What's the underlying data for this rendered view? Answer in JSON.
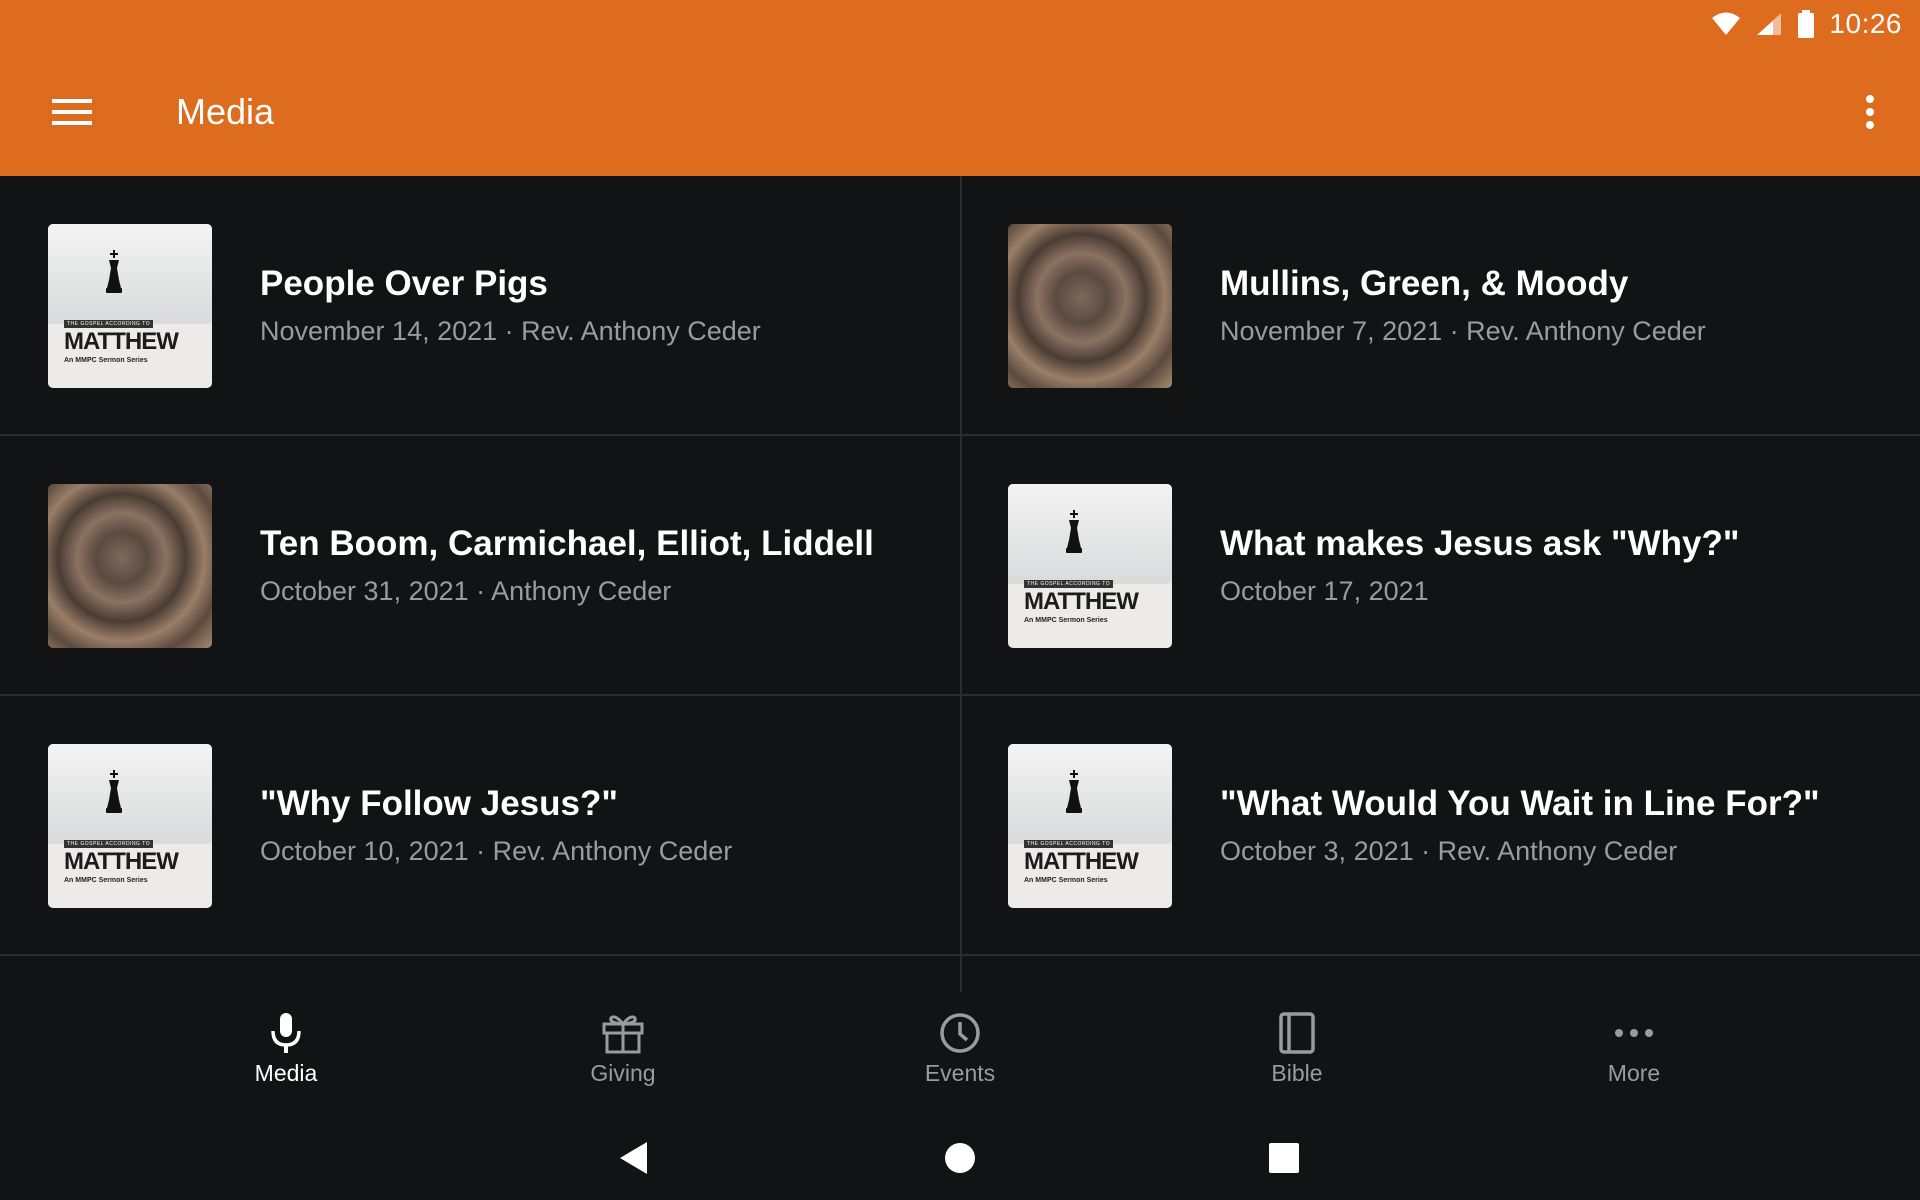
{
  "status_bar": {
    "time": "10:26"
  },
  "app_bar": {
    "title": "Media"
  },
  "items": [
    {
      "title": "People Over Pigs",
      "meta": "November 14, 2021 · Rev. Anthony Ceder",
      "thumbnail": "matthew-series"
    },
    {
      "title": "Mullins, Green, & Moody",
      "meta": "November 7, 2021 · Rev. Anthony Ceder",
      "thumbnail": "wood-texture"
    },
    {
      "title": "Ten Boom, Carmichael, Elliot, Liddell",
      "meta": "October 31, 2021 · Anthony Ceder",
      "thumbnail": "wood-texture"
    },
    {
      "title": "What makes Jesus ask \"Why?\"",
      "meta": "October 17, 2021",
      "thumbnail": "matthew-series"
    },
    {
      "title": "\"Why Follow Jesus?\"",
      "meta": "October 10, 2021 · Rev. Anthony Ceder",
      "thumbnail": "matthew-series"
    },
    {
      "title": "\"What Would You Wait in Line For?\"",
      "meta": "October 3, 2021 · Rev. Anthony Ceder",
      "thumbnail": "matthew-series"
    }
  ],
  "thumbnail_text": {
    "small": "THE GOSPEL ACCORDING TO",
    "big": "MATTHEW",
    "sub": "An MMPC Sermon Series"
  },
  "bottom_nav": [
    {
      "label": "Media",
      "icon": "microphone-icon",
      "active": true
    },
    {
      "label": "Giving",
      "icon": "gift-icon",
      "active": false
    },
    {
      "label": "Events",
      "icon": "clock-icon",
      "active": false
    },
    {
      "label": "Bible",
      "icon": "book-icon",
      "active": false
    },
    {
      "label": "More",
      "icon": "more-horizontal-icon",
      "active": false
    }
  ],
  "colors": {
    "app_bar": "#DD6C1F",
    "background": "#121315",
    "divider": "#2b2c2f",
    "secondary_text": "#9a9b9e"
  }
}
